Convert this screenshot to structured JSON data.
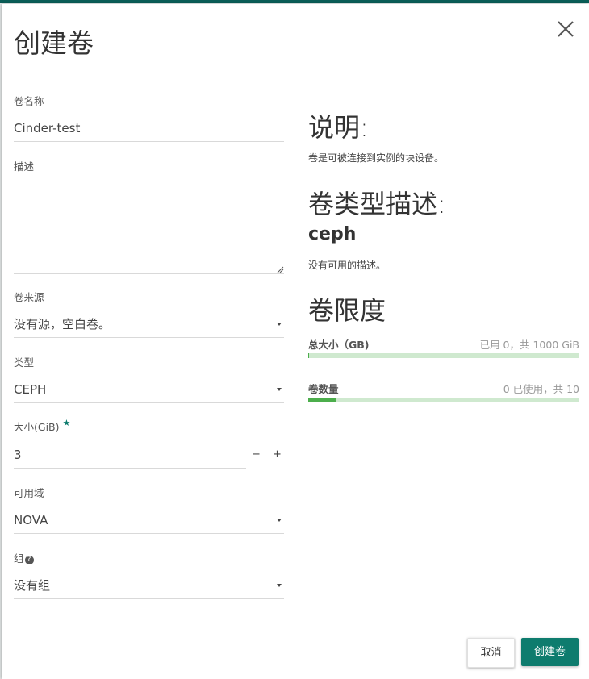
{
  "modal": {
    "title": "创建卷",
    "close_icon": "close-icon"
  },
  "form": {
    "name": {
      "label": "卷名称",
      "value": "Cinder-test"
    },
    "description": {
      "label": "描述",
      "value": ""
    },
    "source": {
      "label": "卷来源",
      "value": "没有源，空白卷。"
    },
    "type": {
      "label": "类型",
      "value": "CEPH"
    },
    "size": {
      "label": "大小(GiB)",
      "required_mark": "★",
      "value": "3",
      "decrement": "−",
      "increment": "+"
    },
    "availability_zone": {
      "label": "可用域",
      "value": "NOVA"
    },
    "group": {
      "label": "组",
      "help_icon": "question-circle-icon",
      "help_glyph": "?",
      "value": "没有组"
    }
  },
  "info": {
    "heading": "说明:",
    "text": "卷是可被连接到实例的块设备。",
    "type_heading": "卷类型描述:",
    "type_name": "ceph",
    "type_text": "没有可用的描述。",
    "limits_heading": "卷限度",
    "limits": [
      {
        "label": "总大小（GB)",
        "value": "已用 0，共 1000 GiB",
        "fraction": 0.0
      },
      {
        "label": "卷数量",
        "value": "0 已使用，共 10",
        "fraction": 0.1
      }
    ]
  },
  "buttons": {
    "cancel": "取消",
    "create": "创建卷"
  },
  "colors": {
    "primary": "#0e7c6e",
    "bar_bg": "#cfe9cf",
    "bar_fill": "#4cae4c"
  }
}
